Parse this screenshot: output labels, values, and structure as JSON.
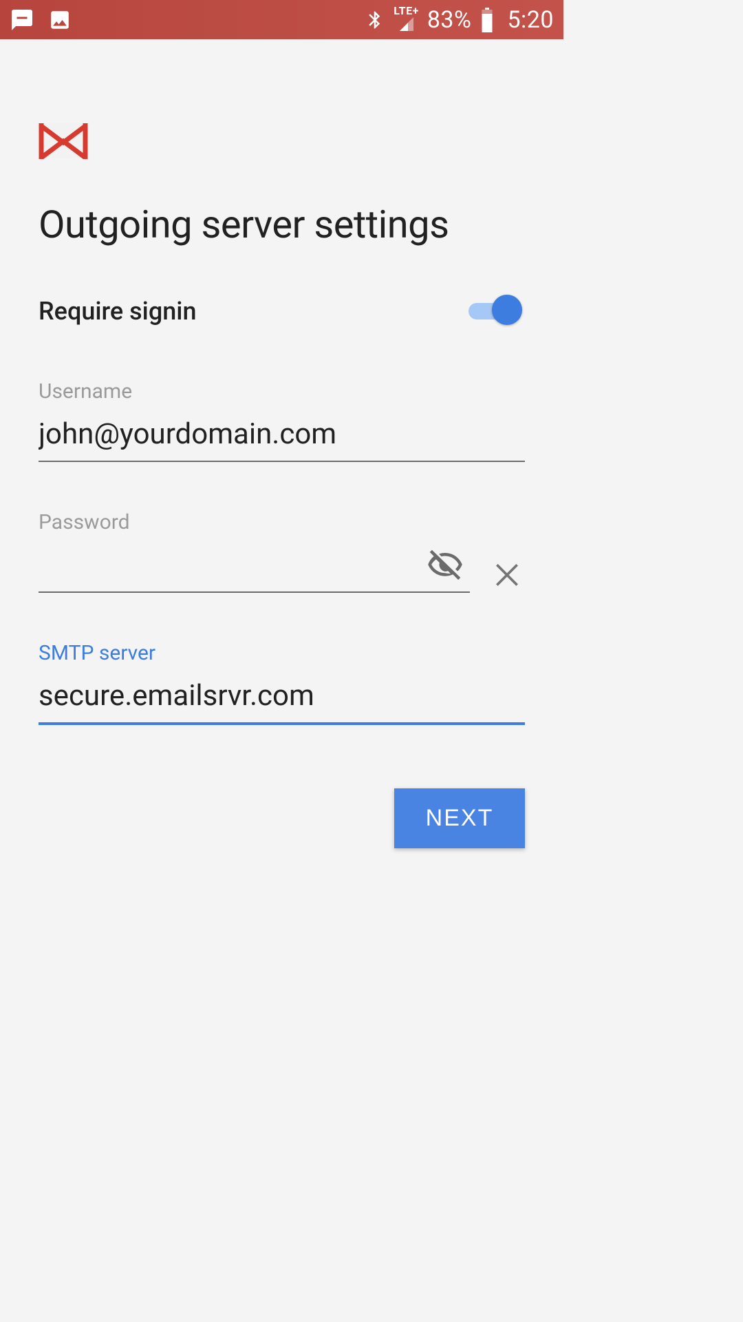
{
  "status_bar": {
    "network_label": "LTE+",
    "battery_pct": "83%",
    "time": "5:20"
  },
  "form": {
    "title": "Outgoing server settings",
    "require_signin_label": "Require signin",
    "require_signin_on": true,
    "username_label": "Username",
    "username_value": "john@yourdomain.com",
    "password_label": "Password",
    "password_value": "",
    "smtp_label": "SMTP server",
    "smtp_value": "secure.emailsrvr.com",
    "next_label": "NEXT"
  },
  "colors": {
    "accent": "#3d7de0",
    "status_bar": "#bb4c44"
  }
}
